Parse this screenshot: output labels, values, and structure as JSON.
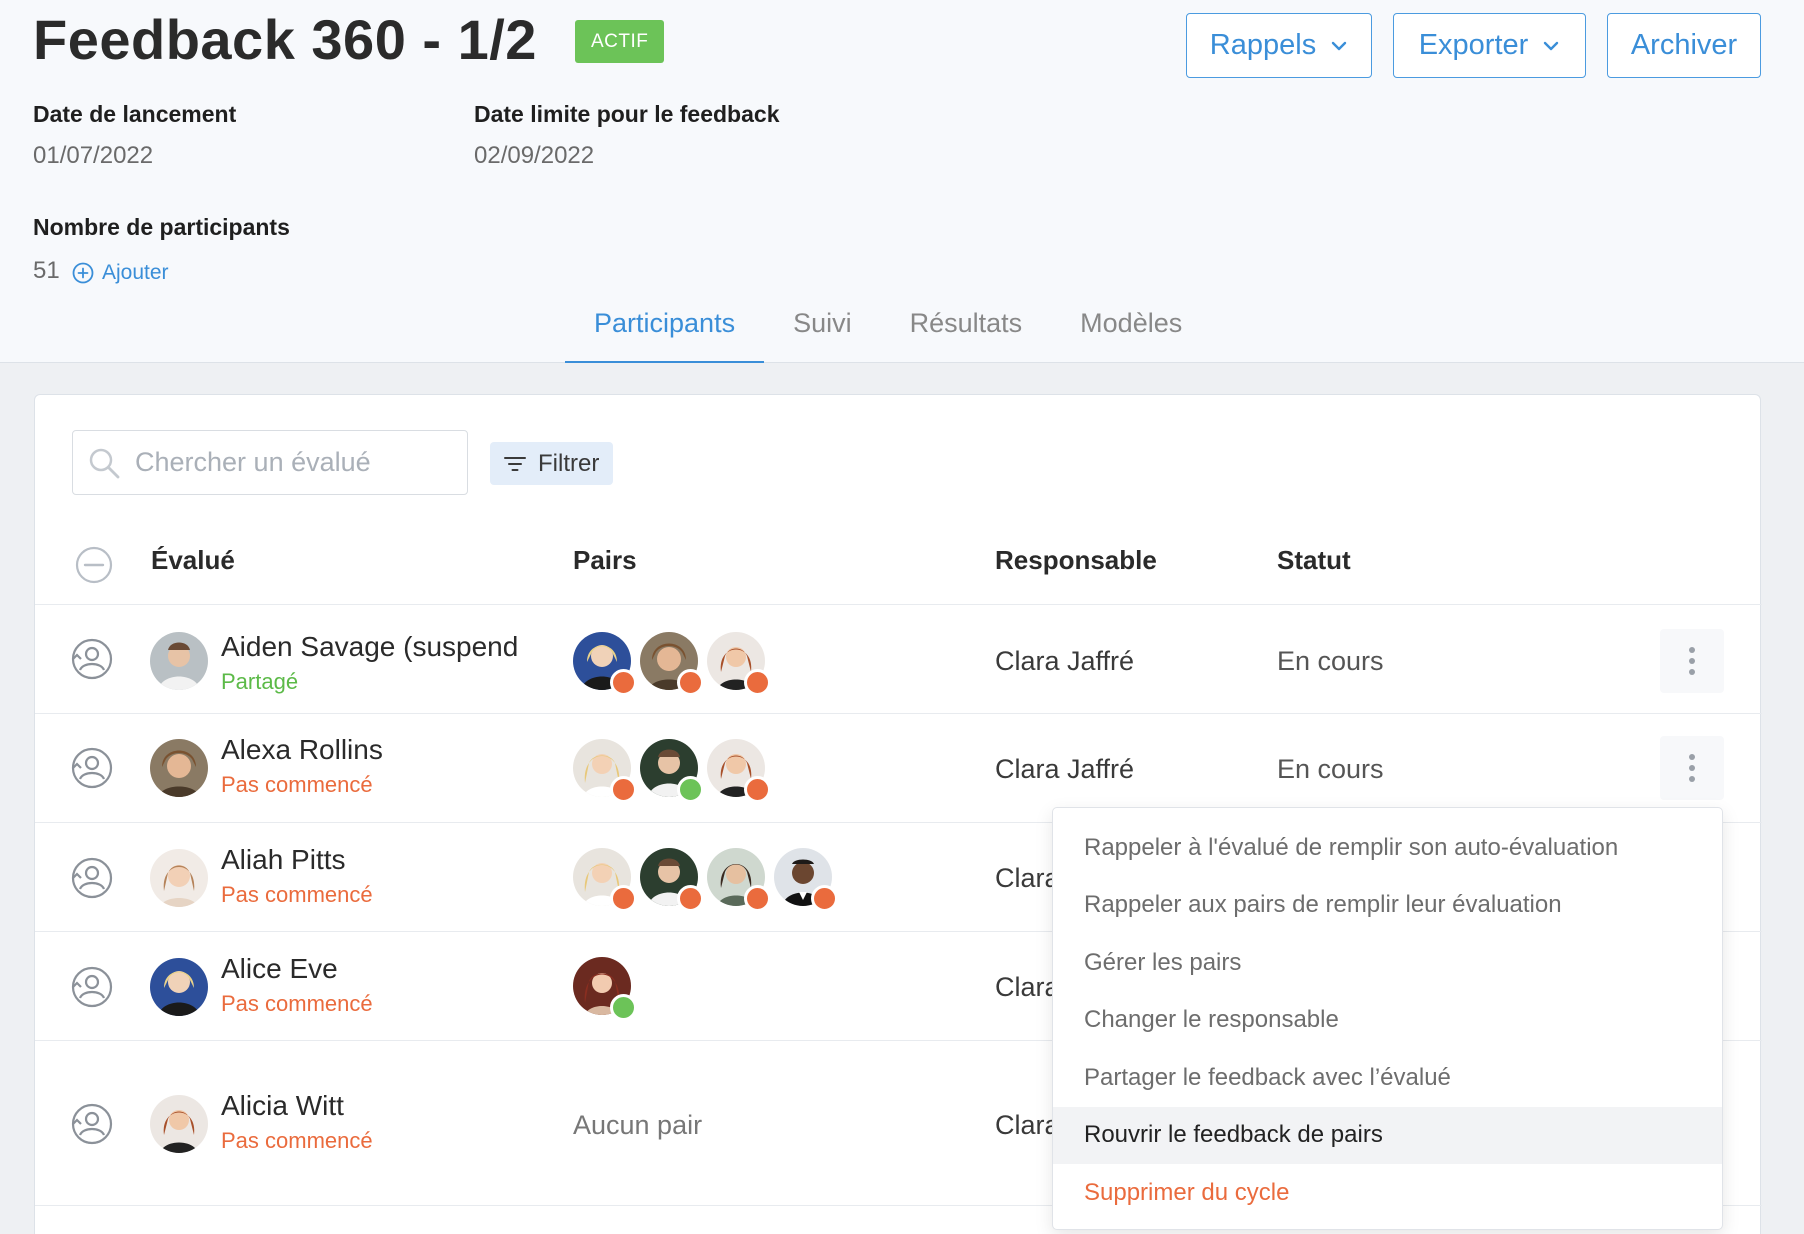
{
  "header": {
    "title": "Feedback 360 - 1/2",
    "status_badge": "ACTIF",
    "buttons": {
      "reminders": "Rappels",
      "export": "Exporter",
      "archive": "Archiver"
    }
  },
  "meta": {
    "launch_label": "Date de lancement",
    "launch_value": "01/07/2022",
    "deadline_label": "Date limite pour le feedback",
    "deadline_value": "02/09/2022",
    "participants_label": "Nombre de participants",
    "participants_count": "51",
    "add_label": "Ajouter"
  },
  "tabs": [
    "Participants",
    "Suivi",
    "Résultats",
    "Modèles"
  ],
  "active_tab": "Participants",
  "toolbar": {
    "search_placeholder": "Chercher un évalué",
    "filter_label": "Filtrer"
  },
  "table": {
    "headers": {
      "evaluee": "Évalué",
      "peers": "Pairs",
      "manager": "Responsable",
      "status": "Statut"
    },
    "rows": [
      {
        "name": "Aiden Savage (suspend",
        "share_status": "Partagé",
        "manager": "Clara Jaffré",
        "status": "En cours"
      },
      {
        "name": "Alexa Rollins",
        "share_status": "Pas commencé",
        "manager": "Clara Jaffré",
        "status": "En cours"
      },
      {
        "name": "Aliah Pitts",
        "share_status": "Pas commencé",
        "manager": "Clara",
        "status": ""
      },
      {
        "name": "Alice Eve",
        "share_status": "Pas commencé",
        "manager": "Clara",
        "status": ""
      },
      {
        "name": "Alicia Witt",
        "share_status": "Pas commencé",
        "manager": "Clara",
        "status": "",
        "no_peer_label": "Aucun pair"
      }
    ]
  },
  "context_menu": {
    "items": [
      "Rappeler à l'évalué de remplir son auto-évaluation",
      "Rappeler aux pairs de remplir leur évaluation",
      "Gérer les pairs",
      "Changer le responsable",
      "Partager le feedback avec l’évalué",
      "Rouvrir le feedback de pairs",
      "Supprimer du cycle"
    ]
  },
  "colors": {
    "accent": "#3a8ed8",
    "badge_green": "#6cc358",
    "status_green": "#5cba48",
    "status_orange": "#ea6b3d"
  }
}
